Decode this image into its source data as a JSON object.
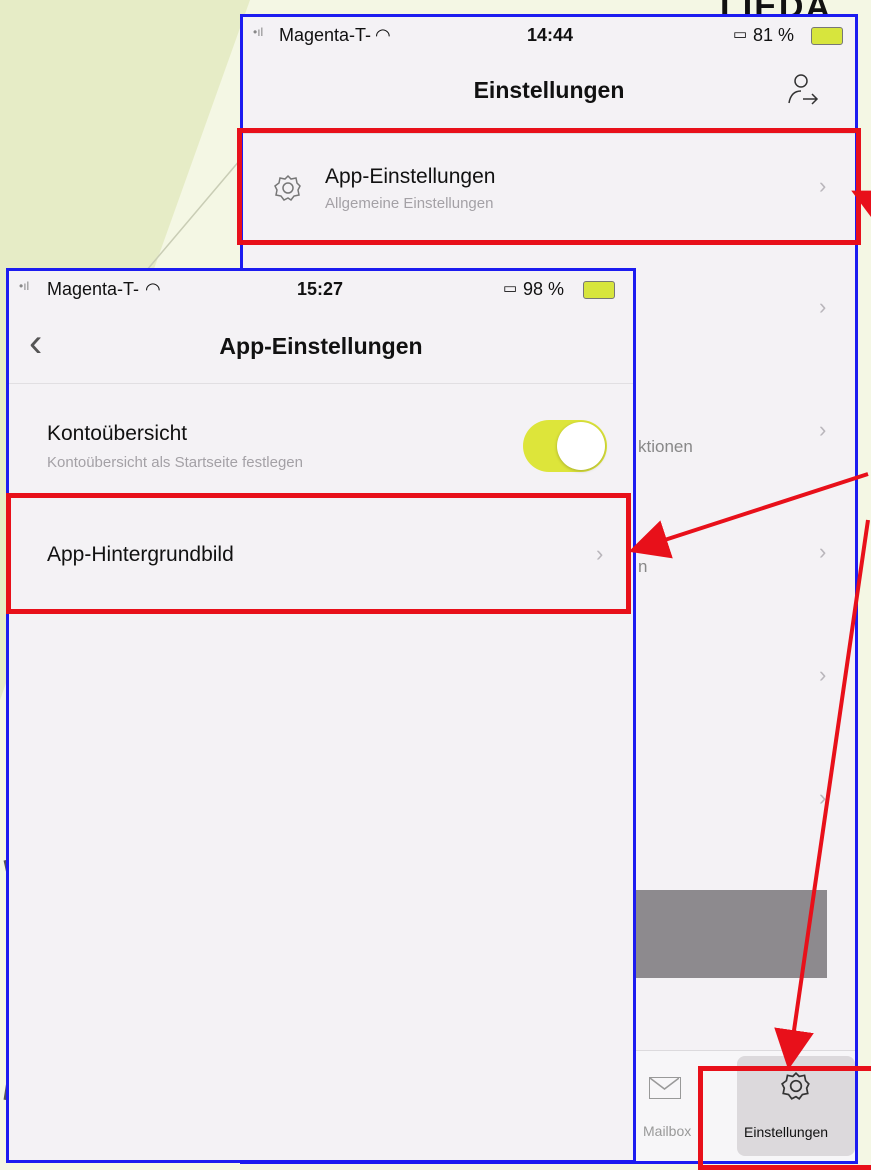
{
  "heading_fragment": "LIEDA",
  "back_screen": {
    "status": {
      "carrier": "Magenta-T-",
      "time": "14:44",
      "battery": "81 %"
    },
    "title": "Einstellungen",
    "icons": {
      "header_right": "user-transfer-icon",
      "row": "gear-icon"
    },
    "app_settings_row": {
      "title": "App-Einstellungen",
      "subtitle": "Allgemeine Einstellungen"
    },
    "partial_row_text": "ktionen",
    "partial_row_text2": "n",
    "tabbar": {
      "mailbox_label": "Mailbox",
      "settings_label": "Einstellungen"
    }
  },
  "front_screen": {
    "status": {
      "carrier": "Magenta-T-",
      "time": "15:27",
      "battery": "98 %"
    },
    "title": "App-Einstellungen",
    "back_icon": "chevron-left-icon",
    "konto_row": {
      "title": "Kontoübersicht",
      "subtitle": "Kontoübersicht als Startseite festlegen",
      "toggle_on": true
    },
    "wallpaper_row": {
      "title": "App-Hintergrundbild"
    }
  },
  "colors": {
    "highlight_red": "#e8101a",
    "frame_blue": "#1c1cf0",
    "toggle_yellow": "#dde53a"
  }
}
